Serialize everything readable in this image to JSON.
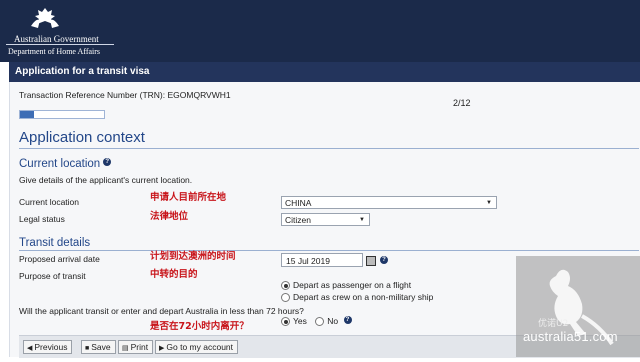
{
  "header": {
    "gov_line1": "Australian Government",
    "gov_line2": "Department of Home Affairs"
  },
  "titlebar": {
    "title": "Application for a transit visa"
  },
  "trn": {
    "label": "Transaction Reference Number (TRN): EGOMQRVWH1"
  },
  "pager": {
    "text": "2/12",
    "progress_fraction": 0.17
  },
  "section": {
    "title": "Application context"
  },
  "current_location": {
    "heading": "Current location",
    "help_icon": "help-icon",
    "instructions": "Give details of the applicant's current location.",
    "location_label": "Current location",
    "location_value": "CHINA",
    "location_note_cn": "申请人目前所在地",
    "legal_label": "Legal status",
    "legal_value": "Citizen",
    "legal_note_cn": "法律地位"
  },
  "transit_details": {
    "heading": "Transit details",
    "arrival_label": "Proposed arrival date",
    "arrival_value": "15 Jul 2019",
    "arrival_note_cn": "计划到达澳洲的时间",
    "purpose_label": "Purpose of transit",
    "purpose_note_cn": "中转的目的",
    "purpose_options": [
      "Depart as passenger on a flight",
      "Depart as crew on a non-military ship"
    ],
    "question": "Will the applicant transit or enter and depart Australia in less than 72 hours?",
    "question_note_cn": "是否在72小时内离开？",
    "yes_label": "Yes",
    "no_label": "No"
  },
  "footer": {
    "previous": "Previous",
    "save": "Save",
    "print": "Print",
    "goto": "Go to my account"
  },
  "watermark": {
    "brand_cn": "优诺U2",
    "site": "australia51.com"
  },
  "colors": {
    "header_bg": "#1b2a4a",
    "heading_blue": "#234789",
    "note_red": "#c8151b"
  }
}
